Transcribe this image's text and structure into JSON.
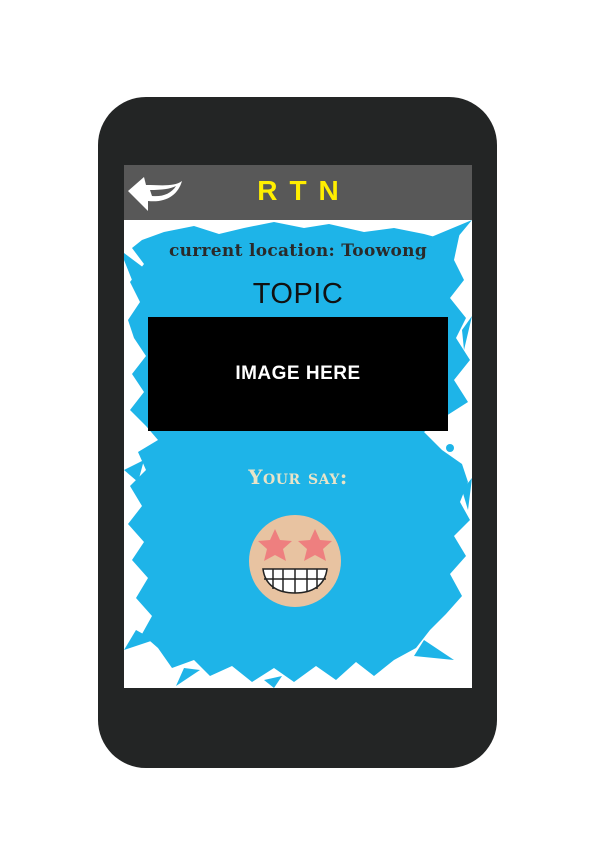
{
  "app": {
    "title": "RTN"
  },
  "location": {
    "text": "current location: Toowong"
  },
  "topic": {
    "heading": "TOPIC"
  },
  "image_placeholder": {
    "text": "IMAGE HERE"
  },
  "feedback": {
    "label": "Your say:",
    "emoji": "star-struck-grin-emoji"
  },
  "icons": {
    "back": "back-arrow-icon"
  },
  "colors": {
    "phone_body": "#232525",
    "topbar": "#585858",
    "title": "#ffee00",
    "splash": "#1eb4e8",
    "emoji_face": "#e8c3a1",
    "emoji_stars": "#ee7f7f"
  }
}
